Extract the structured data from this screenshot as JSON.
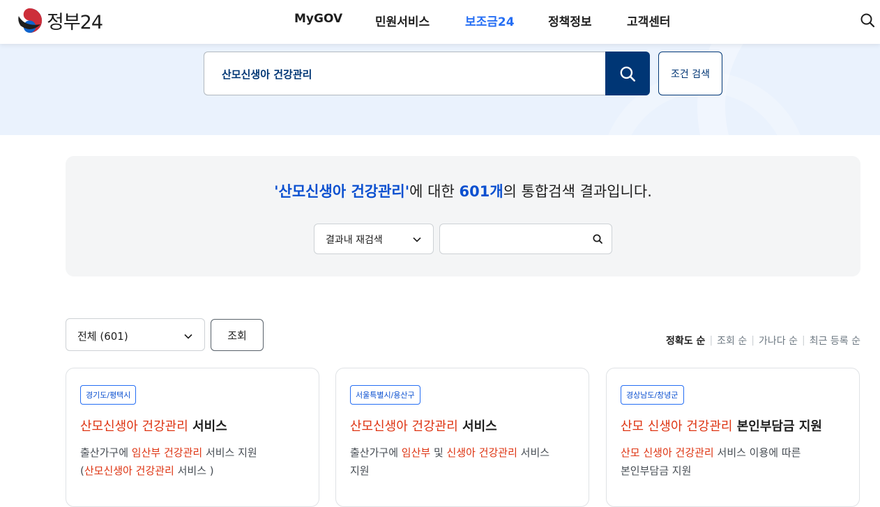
{
  "header": {
    "logo_text": "정부24",
    "nav": [
      "MyGOV",
      "민원서비스",
      "보조금24",
      "정책정보",
      "고객센터"
    ],
    "active_nav": "보조금24",
    "search_icon": "search-icon"
  },
  "search": {
    "value": "산모신생아 건강관리",
    "condition_button": "조건 검색",
    "button_icon": "search-icon"
  },
  "summary": {
    "query_quoted": "'산모신생아 건강관리'",
    "text_a": "에 대한 ",
    "count": "601개",
    "text_b": "의 통합검색 결과입니다.",
    "refine_select": "결과내 재검색",
    "refine_placeholder": ""
  },
  "filter": {
    "select_label": "전체 (601)",
    "query_button": "조회",
    "sort_options": [
      "정확도 순",
      "조회 순",
      "가나다 순",
      "최근 등록 순"
    ],
    "active_sort": "정확도 순"
  },
  "cards": [
    {
      "tag": "경기도/평택시",
      "title_red": "산모신생아 건강관리",
      "title_rest": " 서비스",
      "desc1_a": "출산가구에 ",
      "desc1_red1": "임산부",
      "desc1_b": " ",
      "desc1_red2": "건강관리",
      "desc1_c": " 서비스 지원",
      "desc2_a": "(",
      "desc2_red": "산모신생아 건강관리",
      "desc2_b": " 서비스 )"
    },
    {
      "tag": "서울특별시/용산구",
      "title_red": "산모신생아 건강관리",
      "title_rest": " 서비스",
      "desc1_a": "출산가구에 ",
      "desc1_red1": "임산부",
      "desc1_b": " 및 ",
      "desc1_red2": "신생아 건강관리",
      "desc1_c": " 서비스",
      "desc2_a": "지원",
      "desc2_red": "",
      "desc2_b": ""
    },
    {
      "tag": "경상남도/창녕군",
      "title_red": "산모 신생아 건강관리",
      "title_rest": " 본인부담금 지원",
      "desc1_a": "",
      "desc1_red1": "산모 신생아 건강관리",
      "desc1_b": " 서비스 이용에 따른",
      "desc1_red2": "",
      "desc1_c": "",
      "desc2_a": "본인부담금 지원",
      "desc2_red": "",
      "desc2_b": ""
    }
  ],
  "colors": {
    "brand_navy": "#003675",
    "accent_blue": "#256ef4",
    "highlight_red": "#de3412",
    "banner_bg": "#eaf2fd"
  }
}
